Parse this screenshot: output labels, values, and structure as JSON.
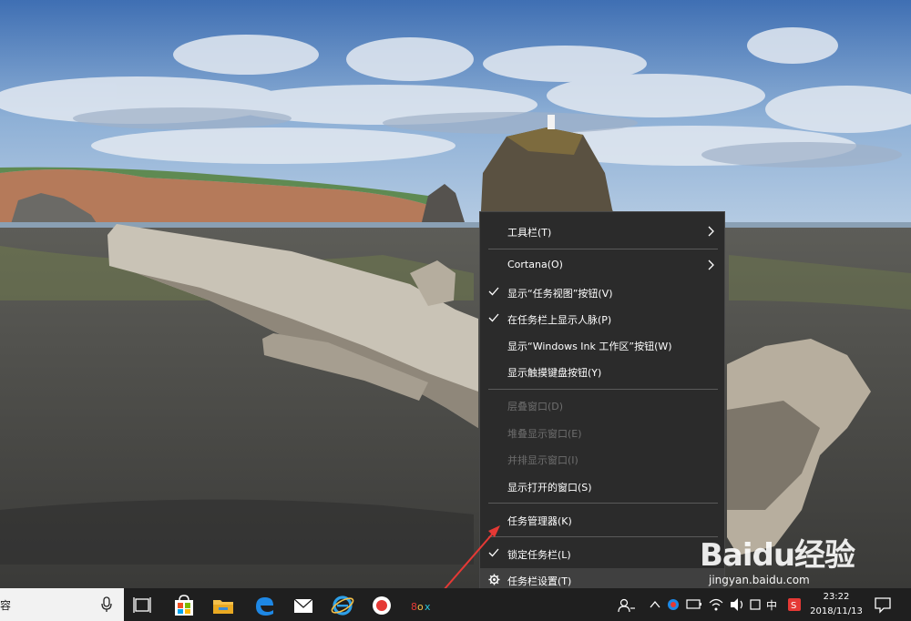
{
  "context_menu": {
    "items": [
      {
        "label": "工具栏(T)"
      },
      {
        "label": "Cortana(O)"
      },
      {
        "label": "显示“任务视图”按钮(V)"
      },
      {
        "label": "在任务栏上显示人脉(P)"
      },
      {
        "label": "显示“Windows Ink 工作区”按钮(W)"
      },
      {
        "label": "显示触摸键盘按钮(Y)"
      },
      {
        "label": "层叠窗口(D)"
      },
      {
        "label": "堆叠显示窗口(E)"
      },
      {
        "label": "并排显示窗口(I)"
      },
      {
        "label": "显示打开的窗口(S)"
      },
      {
        "label": "任务管理器(K)"
      },
      {
        "label": "锁定任务栏(L)"
      },
      {
        "label": "任务栏设置(T)"
      }
    ]
  },
  "taskbar": {
    "search_text": "容",
    "input_method": "中",
    "clock_time": "23:22",
    "clock_date": "2018/11/13"
  },
  "watermark": {
    "brand": "Baidu经验",
    "url": "jingyan.baidu.com"
  },
  "colors": {
    "menu_bg": "#2b2b2b",
    "menu_text": "#ffffff",
    "menu_disabled": "#6e6e6e",
    "taskbar_bg": "#1f1f1f",
    "annotation_arrow": "#e53935"
  },
  "icons": [
    "chevron-right-icon",
    "check-icon",
    "gear-icon",
    "microphone-icon",
    "task-view-icon",
    "store-icon",
    "file-explorer-icon",
    "edge-icon",
    "mail-icon",
    "internet-explorer-icon",
    "record-icon",
    "app-icon",
    "people-icon",
    "chevron-up-icon",
    "network-icon",
    "volume-icon",
    "sogou-icon",
    "notification-icon"
  ]
}
